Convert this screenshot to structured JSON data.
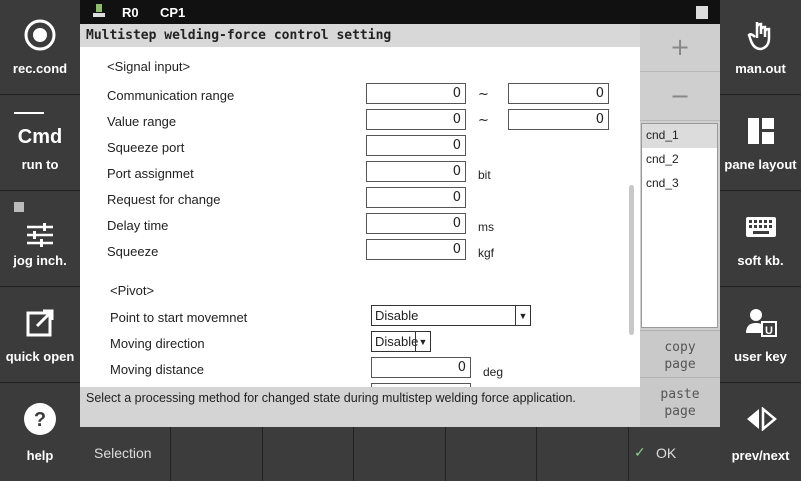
{
  "left_panel": [
    {
      "label": "rec.cond",
      "icon": "record-circle-icon"
    },
    {
      "label": "Cmd",
      "sub": "run to",
      "icon": "cmd-icon"
    },
    {
      "label": "jog inch.",
      "icon": "sliders-icon"
    },
    {
      "label": "quick open",
      "icon": "external-open-icon"
    },
    {
      "label": "help",
      "icon": "help-circle-icon"
    }
  ],
  "right_panel": [
    {
      "label": "man.out",
      "icon": "hand-pointer-icon"
    },
    {
      "label": "pane layout",
      "icon": "layout-icon"
    },
    {
      "label": "soft kb.",
      "icon": "keyboard-icon"
    },
    {
      "label": "user key",
      "icon": "user-key-icon"
    },
    {
      "label": "prev/next",
      "icon": "prev-next-icon"
    }
  ],
  "status": {
    "robot": "R0",
    "program": "CP1"
  },
  "title": "Multistep welding-force control setting",
  "signal_section": "<Signal input>",
  "signal_rows": [
    {
      "label": "Communication range",
      "value": "0",
      "value2": "0",
      "tilde": "~",
      "unit": ""
    },
    {
      "label": "Value range",
      "value": "0",
      "value2": "0",
      "tilde": "~",
      "unit": ""
    },
    {
      "label": "Squeeze port",
      "value": "0",
      "unit": ""
    },
    {
      "label": "Port assignmet",
      "value": "0",
      "unit": "bit"
    },
    {
      "label": "Request for change",
      "value": "0",
      "unit": ""
    },
    {
      "label": "Delay time",
      "value": "0",
      "unit": "ms"
    },
    {
      "label": "Squeeze",
      "value": "0",
      "unit": "kgf"
    }
  ],
  "pivot_section": "<Pivot>",
  "pivot_rows": [
    {
      "label": "Point to start movemnet",
      "value": "Disable"
    },
    {
      "label": "Moving direction",
      "value": "Disable"
    },
    {
      "label": "Moving distance",
      "value": "0",
      "unit": "deg"
    }
  ],
  "rpanel": {
    "plus": "+",
    "minus": "−",
    "items": [
      "cnd_1",
      "cnd_2",
      "cnd_3"
    ],
    "selected": "cnd_1",
    "copy": "copy page",
    "paste": "paste page"
  },
  "info": "Select a processing method for changed state during multistep welding force application.",
  "tabs": {
    "selection": "Selection",
    "ok": "OK"
  }
}
